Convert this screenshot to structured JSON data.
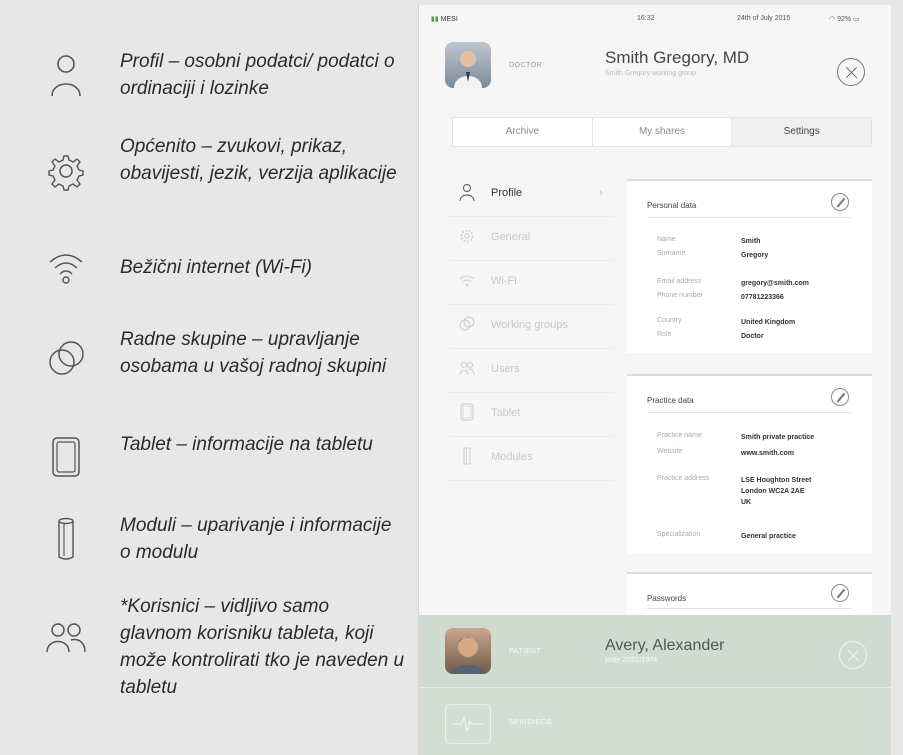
{
  "legend": [
    {
      "icon": "profile-icon",
      "text": "Profil – osobni podatci/ podatci o ordinaciji i lozinke"
    },
    {
      "icon": "gear-icon",
      "text": "Općenito – zvukovi, prikaz, obavijesti, jezik, verzija aplikacije"
    },
    {
      "icon": "wifi-icon",
      "text": "Bežični internet (Wi-Fi)"
    },
    {
      "icon": "working-groups-icon",
      "text": "Radne skupine – upravljanje osobama u vašoj radnoj skupini"
    },
    {
      "icon": "tablet-icon",
      "text": "Tablet – informacije na tabletu"
    },
    {
      "icon": "module-icon",
      "text": "Moduli – uparivanje i informacije o modulu"
    },
    {
      "icon": "users-icon",
      "text": "*Korisnici – vidljivo samo glavnom korisniku tableta, koji može kontrolirati tko je naveden u tabletu"
    }
  ],
  "tablet": {
    "status": {
      "carrier": "MESI",
      "time": "16:32",
      "date": "24th of July 2015",
      "battery": "92%"
    },
    "doctor": {
      "role": "DOCTOR",
      "name": "Smith Gregory, MD",
      "group": "Smith Gregory working group"
    },
    "tabs": [
      {
        "label": "Archive",
        "active": false
      },
      {
        "label": "My shares",
        "active": false
      },
      {
        "label": "Settings",
        "active": true
      }
    ],
    "sidebar": [
      {
        "label": "Profile",
        "icon": "profile-icon",
        "active": true
      },
      {
        "label": "General",
        "icon": "gear-icon",
        "active": false
      },
      {
        "label": "Wi-Fi",
        "icon": "wifi-icon",
        "active": false
      },
      {
        "label": "Working groups",
        "icon": "working-groups-icon",
        "active": false
      },
      {
        "label": "Users",
        "icon": "users-icon",
        "active": false
      },
      {
        "label": "Tablet",
        "icon": "tablet-icon",
        "active": false
      },
      {
        "label": "Modules",
        "icon": "module-icon",
        "active": false
      }
    ],
    "personal": {
      "title": "Personal data",
      "fields": [
        {
          "k": "Name",
          "v": "Smith"
        },
        {
          "k": "Surname",
          "v": "Gregory"
        },
        {
          "k": "Email address",
          "v": "gregory@smith.com"
        },
        {
          "k": "Phone number",
          "v": "07781223366"
        },
        {
          "k": "Country",
          "v": "United Kingdom"
        },
        {
          "k": "Role",
          "v": "Doctor"
        }
      ]
    },
    "practice": {
      "title": "Practice data",
      "fields": [
        {
          "k": "Practice name",
          "v": "Smith private practice"
        },
        {
          "k": "Website",
          "v": "www.smith.com"
        },
        {
          "k": "Practice address",
          "v": "LSE Houghton Street\nLondon WC2A 2AE\nUK"
        },
        {
          "k": "Specialization",
          "v": "General practice"
        }
      ]
    },
    "passwords": {
      "title": "Passwords"
    },
    "patient": {
      "role": "PATIENT",
      "name": "Avery, Alexander",
      "sub": "Male 22/01/1974"
    },
    "ecg": {
      "label": "SPIRO/ECG"
    }
  }
}
